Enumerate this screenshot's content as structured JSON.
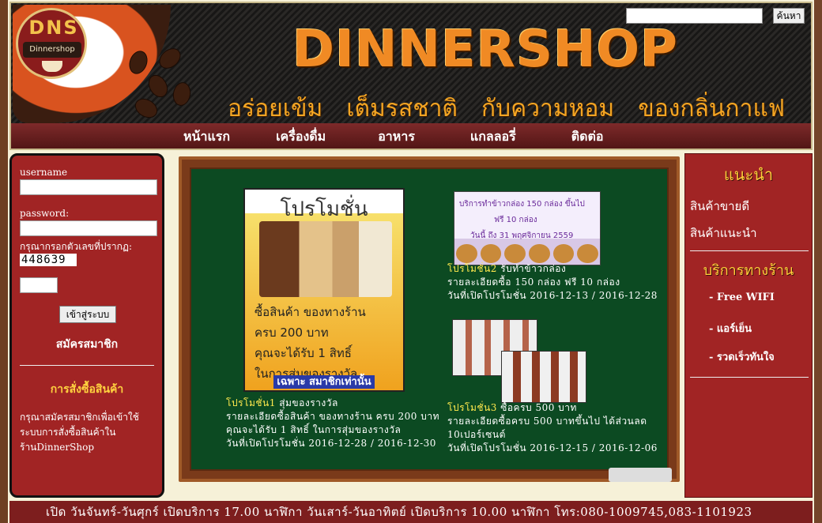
{
  "header": {
    "logo_top": "DNS",
    "logo_sub": "Dinnershop",
    "brand": "DINNERSHOP",
    "slogan": [
      "อร่อยเข้ม",
      "เต็มรสชาติ",
      "กับความหอม",
      "ของกลิ่นกาแฟ"
    ],
    "search_button": "ค้นหา"
  },
  "nav": [
    "หน้าแรก",
    "เครื่องดื่ม",
    "อาหาร",
    "แกลลอรี่",
    "ติดต่อ"
  ],
  "left": {
    "username_label": "username",
    "password_label": "password:",
    "captcha_label": "กรุณากรอกตัวเลขที่ปรากฏ:",
    "captcha_code": "448639",
    "login_button": "เข้าสู่ระบบ",
    "register": "สมัครสมาชิก",
    "order_title": "การสั่งซื้อสินค้า",
    "order_text": "กรุณาสมัครสมาชิกเพื่อเข้าใช้ระบบการสั่งซื้อสินค้าในร้านDinnerShop"
  },
  "promo1": {
    "poster_title": "โปรโมชั่น",
    "poster_lines": [
      "ซื้อสินค้า ของทางร้าน",
      "ครบ 200 บาท",
      "คุณจะได้รับ 1 สิทธิ์",
      "ในการสุ่มของรางวัล"
    ],
    "poster_badge": "เฉพาะ สมาชิกเท่านั้น",
    "name": "โปรโมชั่น1",
    "title": "สุ่มของรางวัล",
    "detail": "รายละเอียดซื้อสินค้า ของทางร้าน ครบ 200 บาท คุณจะได้รับ 1 สิทธิ์ ในการสุ่มของรางวัล",
    "dates": "วันที่เปิดโปรโมชั่น 2016-12-28 / 2016-12-30"
  },
  "promo2": {
    "poster_lines": [
      "บริการทำข้าวกล่อง 150 กล่อง ขึ้นไป",
      "ฟรี 10 กล่อง",
      "วันนี้ ถึง 31 พฤศจิกายน 2559"
    ],
    "name": "โปรโมชั่น2",
    "title": "รับทำข้าวกล่อง",
    "detail": "รายละเอียดซื้อ 150 กล่อง ฟรี 10 กล่อง",
    "dates": "วันที่เปิดโปรโมชั่น 2016-12-13 / 2016-12-28"
  },
  "promo3": {
    "name": "โปรโมชั่น3",
    "title": "ซื้อครบ 500 บาท",
    "detail": "รายละเอียดซื้อครบ 500 บาทขึ้นไป ได้ส่วนลด 10เปอร์เซนต์",
    "dates": "วันที่เปิดโปรโมชั่น 2016-12-15 / 2016-12-06"
  },
  "right": {
    "rec_title": "แนะนำ",
    "rec_links": [
      "สินค้าขายดี",
      "สินค้าแนะนำ"
    ],
    "svc_title": "บริการทางร้าน",
    "services": [
      "- Free WIFI",
      "- แอร์เย็น",
      "- รวดเร็วทันใจ"
    ]
  },
  "footer": "เปิด วันจันทร์-วันศุกร์ เปิดบริการ 17.00 นาฬิกา วันเสาร์-วันอาทิตย์ เปิดบริการ 10.00 นาฬิกา โทร:080-1009745,083-1101923"
}
